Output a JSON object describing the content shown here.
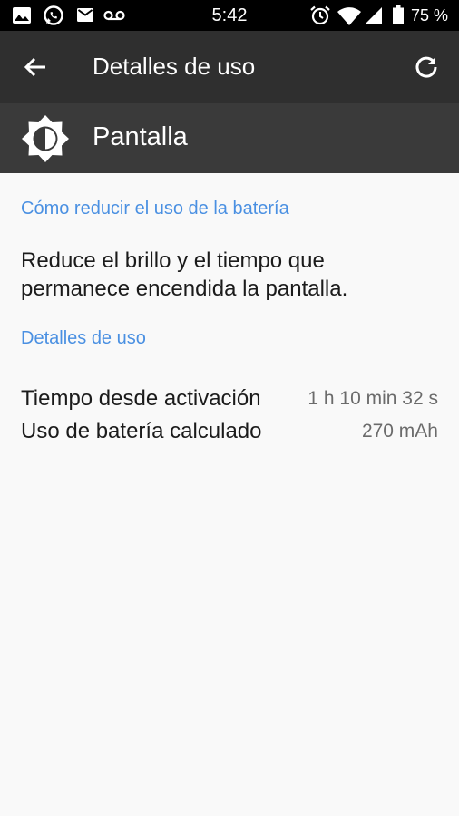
{
  "status_bar": {
    "time": "5:42",
    "battery": "75 %",
    "icons": [
      "image-icon",
      "whatsapp-icon",
      "mail-icon",
      "voicemail-icon",
      "alarm-icon",
      "wifi-icon",
      "signal-icon",
      "battery-icon"
    ]
  },
  "app_bar": {
    "title": "Detalles de uso",
    "back_icon": "arrow-left-icon",
    "refresh_icon": "refresh-icon"
  },
  "sub_header": {
    "title": "Pantalla",
    "icon": "brightness-icon"
  },
  "sections": {
    "reduce_header": "Cómo reducir el uso de la batería",
    "reduce_text": "Reduce el brillo y el tiempo que permanece encendida la pantalla.",
    "details_header": "Detalles de uso"
  },
  "usage": [
    {
      "label": "Tiempo desde activación",
      "value": "1 h 10 min 32 s"
    },
    {
      "label": "Uso de batería calculado",
      "value": "270 mAh"
    }
  ],
  "colors": {
    "accent": "#4a90e2",
    "app_bar": "#2f2f2f",
    "sub_header": "#3a3a3a",
    "background": "#f9f9f9"
  }
}
